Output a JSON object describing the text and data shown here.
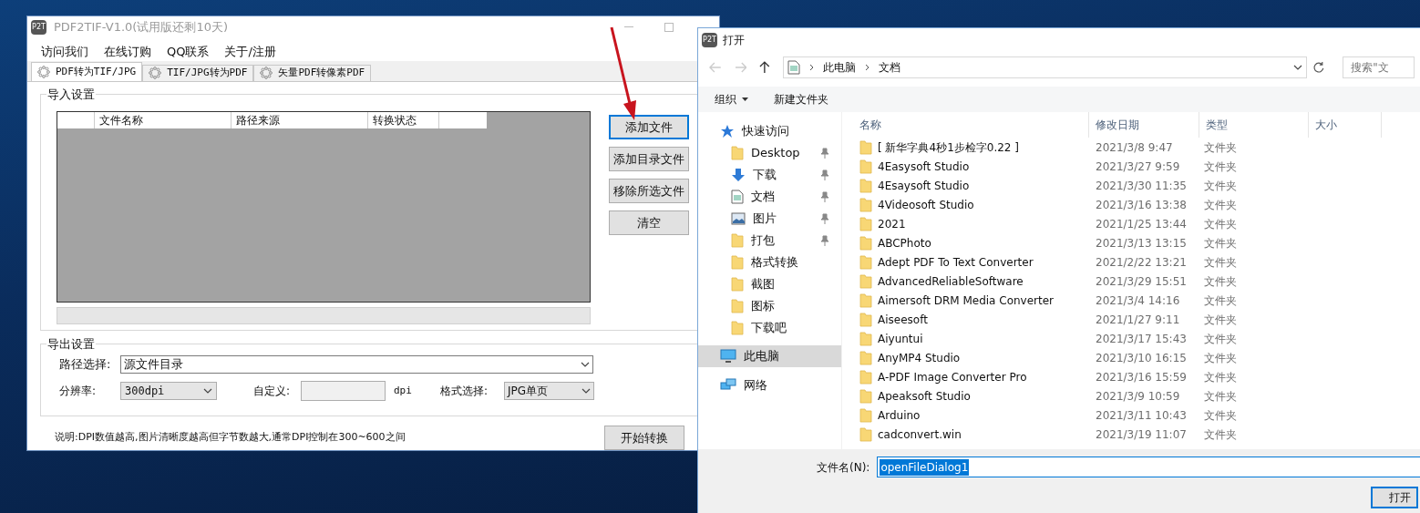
{
  "app_window": {
    "title": "PDF2TIF-V1.0(试用版还剩10天)",
    "logo": "P2T",
    "menu": [
      "访问我们",
      "在线订购",
      "QQ联系",
      "关于/注册"
    ],
    "tabs": [
      {
        "label": "PDF转为TIF/JPG",
        "selected": true
      },
      {
        "label": "TIF/JPG转为PDF",
        "selected": false
      },
      {
        "label": "矢量PDF转像素PDF",
        "selected": false
      }
    ],
    "import_settings": {
      "title": "导入设置",
      "columns": [
        "文件名称",
        "路径来源",
        "转换状态"
      ],
      "buttons": [
        {
          "label": "添加文件",
          "focused": true
        },
        {
          "label": "添加目录文件",
          "focused": false
        },
        {
          "label": "移除所选文件",
          "focused": false
        },
        {
          "label": "清空",
          "focused": false
        }
      ]
    },
    "export_settings": {
      "title": "导出设置",
      "path_label": "路径选择:",
      "path_value": "源文件目录",
      "resolution_label": "分辨率:",
      "resolution_value": "300dpi",
      "custom_label": "自定义:",
      "unit": "dpi",
      "format_label": "格式选择:",
      "format_value": "JPG单页"
    },
    "note": "说明:DPI数值越高,图片清晰度越高但字节数越大,通常DPI控制在300~600之间",
    "start_button": "开始转换"
  },
  "open_dialog": {
    "title": "打开",
    "logo": "P2T",
    "breadcrumb": [
      "此电脑",
      "文档"
    ],
    "search_placeholder": "搜索\"文",
    "organize": "组织",
    "new_folder": "新建文件夹",
    "nav": [
      {
        "label": "快速访问",
        "kind": "star",
        "selected": false,
        "children": [
          {
            "label": "Desktop",
            "kind": "folder",
            "pinned": true
          },
          {
            "label": "下载",
            "kind": "download",
            "pinned": true
          },
          {
            "label": "文档",
            "kind": "document",
            "pinned": true
          },
          {
            "label": "图片",
            "kind": "picture",
            "pinned": true
          },
          {
            "label": "打包",
            "kind": "folder",
            "pinned": true
          },
          {
            "label": "格式转换",
            "kind": "folder",
            "pinned": false
          },
          {
            "label": "截图",
            "kind": "folder",
            "pinned": false
          },
          {
            "label": "图标",
            "kind": "folder",
            "pinned": false
          },
          {
            "label": "下载吧",
            "kind": "folder",
            "pinned": false
          }
        ]
      },
      {
        "label": "此电脑",
        "kind": "computer",
        "selected": true
      },
      {
        "label": "网络",
        "kind": "network",
        "selected": false
      }
    ],
    "columns": [
      "名称",
      "修改日期",
      "类型",
      "大小"
    ],
    "rows": [
      {
        "name": "[ 新华字典4秒1步检字0.22 ]",
        "modified": "2021/3/8 9:47",
        "type": "文件夹"
      },
      {
        "name": "4Easysoft Studio",
        "modified": "2021/3/27 9:59",
        "type": "文件夹"
      },
      {
        "name": "4Esaysoft Studio",
        "modified": "2021/3/30 11:35",
        "type": "文件夹"
      },
      {
        "name": "4Videosoft Studio",
        "modified": "2021/3/16 13:38",
        "type": "文件夹"
      },
      {
        "name": "2021",
        "modified": "2021/1/25 13:44",
        "type": "文件夹"
      },
      {
        "name": "ABCPhoto",
        "modified": "2021/3/13 13:15",
        "type": "文件夹"
      },
      {
        "name": "Adept PDF To Text Converter",
        "modified": "2021/2/22 13:21",
        "type": "文件夹"
      },
      {
        "name": "AdvancedReliableSoftware",
        "modified": "2021/3/29 15:51",
        "type": "文件夹"
      },
      {
        "name": "Aimersoft DRM Media Converter",
        "modified": "2021/3/4 14:16",
        "type": "文件夹"
      },
      {
        "name": "Aiseesoft",
        "modified": "2021/1/27 9:11",
        "type": "文件夹"
      },
      {
        "name": "Aiyuntui",
        "modified": "2021/3/17 15:43",
        "type": "文件夹"
      },
      {
        "name": "AnyMP4 Studio",
        "modified": "2021/3/10 16:15",
        "type": "文件夹"
      },
      {
        "name": "A-PDF Image Converter Pro",
        "modified": "2021/3/16 15:59",
        "type": "文件夹"
      },
      {
        "name": "Apeaksoft Studio",
        "modified": "2021/3/9 10:59",
        "type": "文件夹"
      },
      {
        "name": "Arduino",
        "modified": "2021/3/11 10:43",
        "type": "文件夹"
      },
      {
        "name": "cadconvert.win",
        "modified": "2021/3/19 11:07",
        "type": "文件夹"
      }
    ],
    "filename_label": "文件名(N):",
    "filename_value": "openFileDialog1",
    "open_button": "打开"
  }
}
